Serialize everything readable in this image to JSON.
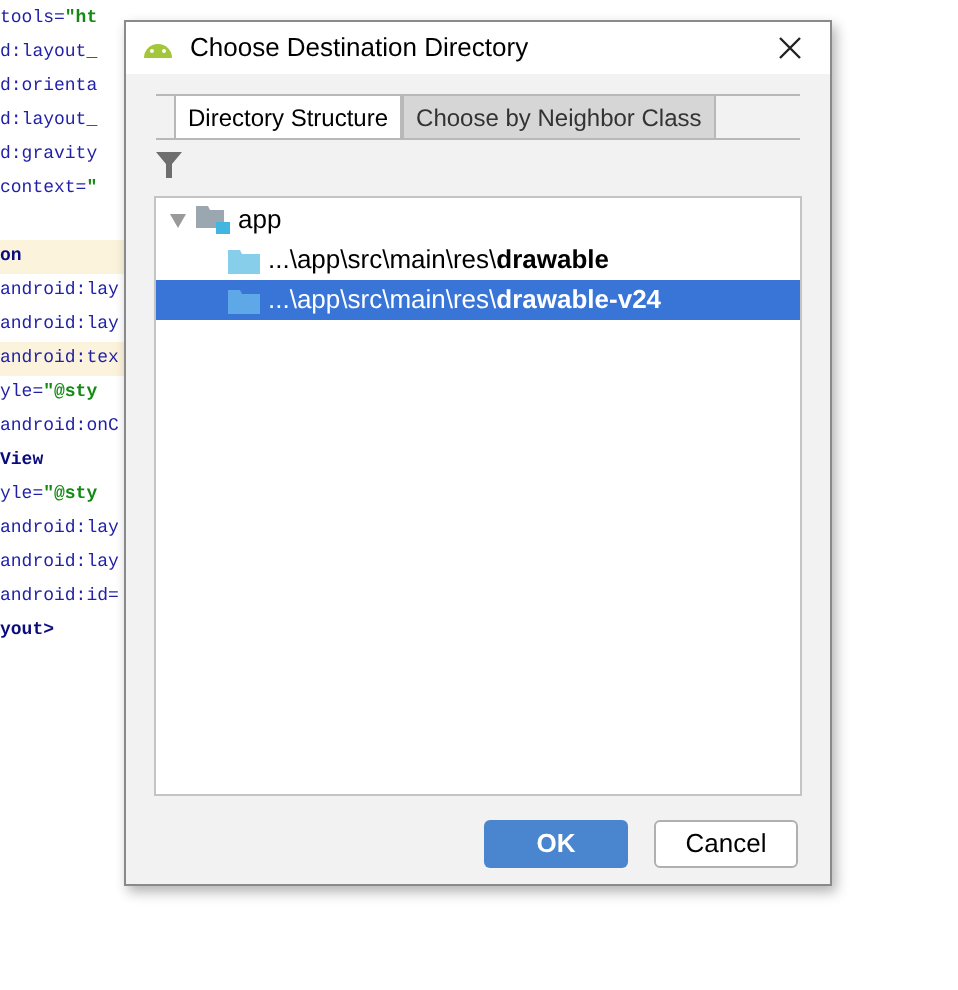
{
  "editor": {
    "lines": [
      {
        "kind": "code",
        "highlighted": false,
        "parts": [
          {
            "kind": "attr",
            "text": " tools="
          },
          {
            "kind": "value",
            "text": "\"ht"
          }
        ]
      },
      {
        "kind": "code",
        "highlighted": false,
        "parts": [
          {
            "kind": "attr",
            "text": "d:layout_"
          }
        ]
      },
      {
        "kind": "code",
        "highlighted": false,
        "parts": [
          {
            "kind": "attr",
            "text": "d:orienta"
          }
        ]
      },
      {
        "kind": "code",
        "highlighted": false,
        "parts": [
          {
            "kind": "attr",
            "text": "d:layout_"
          }
        ]
      },
      {
        "kind": "code",
        "highlighted": false,
        "parts": [
          {
            "kind": "attr",
            "text": "d:gravity"
          }
        ]
      },
      {
        "kind": "code",
        "highlighted": false,
        "parts": [
          {
            "kind": "attr",
            "text": " context="
          },
          {
            "kind": "value",
            "text": "\""
          }
        ]
      },
      {
        "kind": "blank"
      },
      {
        "kind": "code",
        "highlighted": true,
        "parts": [
          {
            "kind": "tag",
            "text": "on"
          }
        ]
      },
      {
        "kind": "code",
        "highlighted": false,
        "parts": [
          {
            "kind": "attr",
            "text": "android:lay"
          }
        ]
      },
      {
        "kind": "code",
        "highlighted": false,
        "parts": [
          {
            "kind": "attr",
            "text": "android:lay"
          }
        ]
      },
      {
        "kind": "code",
        "highlighted": true,
        "parts": [
          {
            "kind": "attr",
            "text": "android:tex"
          }
        ]
      },
      {
        "kind": "code",
        "highlighted": false,
        "parts": [
          {
            "kind": "attr",
            "text": "yle="
          },
          {
            "kind": "value",
            "text": "\"@sty"
          }
        ]
      },
      {
        "kind": "code",
        "highlighted": false,
        "parts": [
          {
            "kind": "attr",
            "text": "android:onC"
          }
        ]
      },
      {
        "kind": "code",
        "highlighted": false,
        "parts": [
          {
            "kind": "tag",
            "text": "View"
          }
        ]
      },
      {
        "kind": "code",
        "highlighted": false,
        "parts": [
          {
            "kind": "attr",
            "text": "yle="
          },
          {
            "kind": "value",
            "text": "\"@sty"
          }
        ]
      },
      {
        "kind": "code",
        "highlighted": false,
        "parts": [
          {
            "kind": "attr",
            "text": "android:lay"
          }
        ]
      },
      {
        "kind": "code",
        "highlighted": false,
        "parts": [
          {
            "kind": "attr",
            "text": "android:lay"
          }
        ]
      },
      {
        "kind": "code",
        "highlighted": false,
        "parts": [
          {
            "kind": "attr",
            "text": "android:id="
          }
        ]
      },
      {
        "kind": "code",
        "highlighted": false,
        "parts": [
          {
            "kind": "tag",
            "text": "yout>"
          }
        ]
      }
    ]
  },
  "dialog": {
    "title": "Choose Destination Directory",
    "tabs": [
      {
        "label": "Directory Structure",
        "selected": true
      },
      {
        "label": "Choose by Neighbor Class",
        "selected": false
      }
    ],
    "tree": [
      {
        "label": "app",
        "kind": "module",
        "expanded": true,
        "selected": false,
        "children": [
          {
            "label": "...\\app\\src\\main\\res\\**drawable**",
            "kind": "folder",
            "selected": false
          },
          {
            "label": "...\\app\\src\\main\\res\\**drawable-v24**",
            "kind": "folder",
            "selected": true
          }
        ]
      }
    ],
    "buttons": [
      {
        "label": "OK",
        "kind": "primary"
      },
      {
        "label": "Cancel",
        "kind": "secondary"
      }
    ]
  }
}
